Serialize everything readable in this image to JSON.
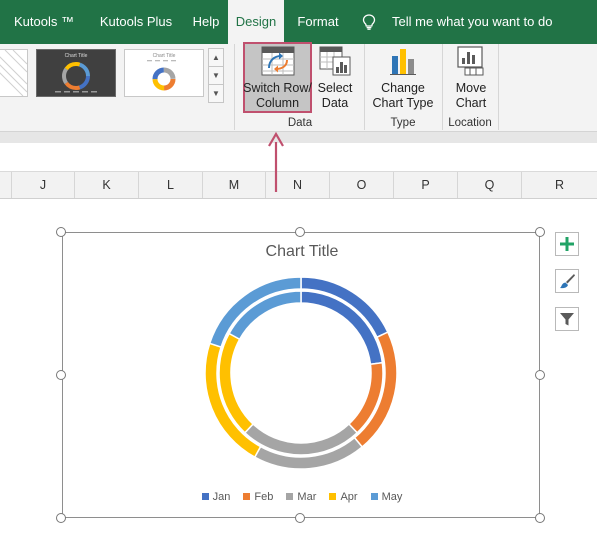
{
  "tabs": [
    {
      "label": "Kutools ™",
      "active": false
    },
    {
      "label": "Kutools Plus",
      "active": false
    },
    {
      "label": "Help",
      "active": false
    },
    {
      "label": "Design",
      "active": true
    },
    {
      "label": "Format",
      "active": false
    }
  ],
  "tell_me": "Tell me what you want to do",
  "gallery": {
    "thumb_title_1": "Chart Title",
    "thumb_title_2": "Chart Title"
  },
  "ribbon": {
    "switch_row_column": {
      "line1": "Switch Row/",
      "line2": "Column"
    },
    "select_data": {
      "line1": "Select",
      "line2": "Data"
    },
    "change_chart_type": {
      "line1": "Change",
      "line2": "Chart Type"
    },
    "move_chart": {
      "line1": "Move",
      "line2": "Chart"
    },
    "groups": {
      "data": "Data",
      "type": "Type",
      "location": "Location"
    }
  },
  "columns": [
    "J",
    "K",
    "L",
    "M",
    "N",
    "O",
    "P",
    "Q",
    "R"
  ],
  "chart_data": {
    "type": "doughnut",
    "title": "Chart Title",
    "categories": [
      "Jan",
      "Feb",
      "Mar",
      "Apr",
      "May"
    ],
    "colors": [
      "#4472c4",
      "#ed7d31",
      "#a5a5a5",
      "#ffc000",
      "#5b9bd5"
    ],
    "series": [
      {
        "values": [
          18,
          21,
          19,
          22,
          20
        ]
      },
      {
        "values": [
          23,
          15,
          24,
          21,
          17
        ]
      }
    ],
    "legend": "bottom"
  }
}
